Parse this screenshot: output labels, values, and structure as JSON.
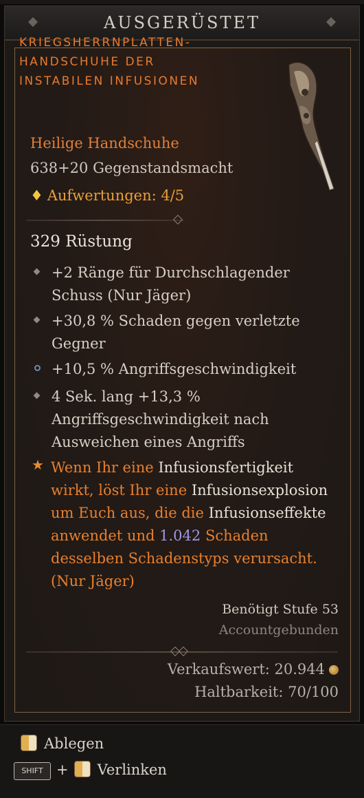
{
  "header": {
    "title": "AUSGERÜSTET"
  },
  "item": {
    "name": "KRIEGSHERRNPLATTEN-HANDSCHUHE DER INSTABILEN INFUSIONEN",
    "type": "Heilige Handschuhe",
    "power": "638+20 Gegenstandsmacht",
    "upgrades": "Aufwertungen: 4/5",
    "armor": "329 Rüstung",
    "affixes": [
      "+2 Ränge für Durchschlagender Schuss (Nur Jäger)",
      "+30,8 % Schaden gegen verletzte Gegner",
      "+10,5 % Angriffsgeschwindigkeit",
      "4 Sek. lang +13,3 % Angriffsgeschwindigkeit nach Ausweichen eines Angriffs"
    ],
    "aspect": {
      "p1": "Wenn Ihr eine ",
      "w1": "Infusionsfertigkeit",
      "p2": " wirkt, löst Ihr eine ",
      "w2": "Infusionsexplosion",
      "p3": " um Euch aus, die die ",
      "w3": "Infusionseffekte",
      "p4": " anwendet und ",
      "v1": "1.042",
      "p5": " Schaden desselben Schadenstyps verursacht. (Nur Jäger)"
    },
    "required_level": "Benötigt Stufe 53",
    "bound": "Accountgebunden",
    "sell_value": "Verkaufswert: 20.944",
    "durability": "Haltbarkeit: 70/100"
  },
  "footer": {
    "drop_label": "Ablegen",
    "shift_key": "SHIFT",
    "plus": "+",
    "link_label": "Verlinken"
  },
  "colors": {
    "legendary_name": "#e87a2e",
    "aspect_text": "#e8802e",
    "value_highlight": "#9f96e8",
    "frame_gold": "#806448"
  },
  "icons": [
    "gem-icon",
    "coin-icon",
    "mouse-icon",
    "weapon-artwork"
  ]
}
